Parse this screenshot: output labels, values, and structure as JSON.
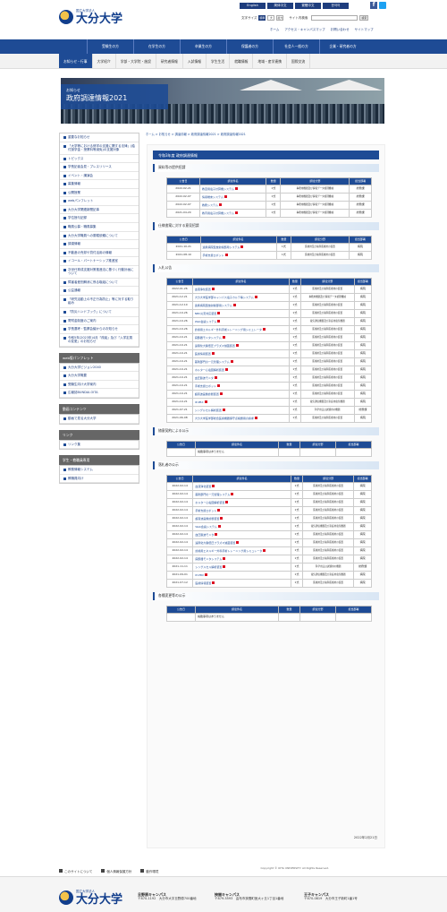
{
  "header": {
    "logo_sub": "国立大学法人",
    "logo_main": "大分大学",
    "langs": [
      "English",
      "简体中文",
      "繁體中文",
      "한국어"
    ],
    "text_size_label": "文字サイズ",
    "sizes": [
      "標準",
      "大",
      "最大"
    ],
    "search_label": "サイト内検索",
    "search_button": "検索",
    "util": [
      "ホーム",
      "アクセス・キャンパスマップ",
      "お問い合わせ",
      "サイトマップ"
    ]
  },
  "gnav": [
    "受験生の方",
    "在学生の方",
    "卒業生の方",
    "保護者の方",
    "社会人一般の方",
    "企業・研究者の方"
  ],
  "snav": [
    {
      "label": "お知らせ・行事",
      "active": true
    },
    {
      "label": "大学紹介",
      "active": false
    },
    {
      "label": "学部・大学院・施設",
      "active": false
    },
    {
      "label": "研究者情報",
      "active": false
    },
    {
      "label": "入試情報",
      "active": false
    },
    {
      "label": "学生生活",
      "active": false
    },
    {
      "label": "就職情報",
      "active": false
    },
    {
      "label": "地域・産学連携",
      "active": false
    },
    {
      "label": "国際交流",
      "active": false
    }
  ],
  "hero": {
    "small": "お知らせ",
    "title": "政府調達情報2021"
  },
  "breadcrumb": "ホーム > お知らせ > 調達情報 > 政府調達情報2021 > 政府調達情報2021",
  "sidebar": {
    "items": [
      "重要なお知らせ",
      "「大学等における修学の支援に関する法律」(給付奨学金・授業料等減免)の支援対象",
      "トピックス",
      "学長記者会見・プレスリリース",
      "イベント・講演会",
      "募集情報",
      "公開授業",
      "webパンフレット",
      "大分大学関連新聞記事",
      "学位授与記録",
      "職員公募・職員募集",
      "大分大学職員への委嘱依頼について",
      "調達情報",
      "不動産の売却や貸付活用の情報",
      "イコール・パートナーシップ推進室",
      "次世代育成支援対策推進法に基づく行動計画について",
      "障害者差別解消に係る取組について",
      "公益通報",
      "「研究活動上の不正行為防止」等に対する取り組み",
      "「防災ハンドブック」について",
      "寄附金制度のご案内",
      "学長選考・監察会議からのお知らせ",
      "令和5年(2023年)4月「改組」及び「入学定員の変更」のお知らせ"
    ],
    "panf_title": "web版パンフレット",
    "panf": [
      "大分大学ビジョン2040",
      "大分大学概要",
      "受験生向け大学案内",
      "広報誌BUNDAI-OITA"
    ],
    "video_title": "動画コンテンツ",
    "video": [
      "動画で見る大分大学"
    ],
    "link_title": "リンク",
    "link": [
      "リンク集"
    ],
    "student_title": "学生・教職員専用",
    "student": [
      "教務情報システム",
      "教職員向け"
    ]
  },
  "main": {
    "page_title": "令和3年度 政府調達情報",
    "s1": {
      "title": "資料等の提供招請",
      "headers": [
        "公告日",
        "調達件名",
        "数量",
        "調達分野",
        "担当部署"
      ],
      "rows": [
        [
          "2022-02-21",
          "教室用電子計算機システム",
          "1式",
          "事務用機器及び情報データ処理機械",
          "総務課"
        ],
        [
          "2022-02-07",
          "情報端末システム",
          "1式",
          "事務用機器及び情報データ処理機械",
          "総務課"
        ],
        [
          "2022-02-07",
          "教務システム",
          "1式",
          "事務用機器及び情報データ処理機械",
          "総務課"
        ],
        [
          "2021-04-20",
          "教育用電子計算機システム",
          "1式",
          "事務用機器及び情報データ処理機械",
          "総務課"
        ]
      ]
    },
    "s2": {
      "title": "仕様書案に対する意見招請",
      "headers": [
        "公告日",
        "調達件名",
        "数量",
        "調達分野",
        "担当部署"
      ],
      "rows": [
        [
          "2021-10-21",
          "連携病院型放射線部用システム",
          "1式",
          "医療用及び歯科医療用の装置",
          "病院"
        ],
        [
          "2021-08-10",
          "手術支援ロボット",
          "1式",
          "医療用及び歯科医療用の装置",
          "病院"
        ]
      ]
    },
    "s3": {
      "title": "入札公告",
      "headers": [
        "公告日",
        "調達件名",
        "数量",
        "調達分野",
        "担当部署"
      ],
      "rows": [
        [
          "2022-01-26",
          "血液浄化装置",
          "1式",
          "医療用及び歯科医療用の装置",
          "病院"
        ],
        [
          "2021-12-21",
          "大分大学医学部キャンパス電子カルテ等システム",
          "1式",
          "事務用機器及び情報データ処理機械",
          "病院"
        ],
        [
          "2021-12-10",
          "連携病院型放射線部用システム",
          "1式",
          "医療用及び歯科医療用の装置",
          "病院"
        ],
        [
          "2021-10-26",
          "NBC災害対応装置",
          "1式",
          "医療用及び歯科医療用の装置",
          "病院"
        ],
        [
          "2021-10-26",
          "Web会議システム",
          "1式",
          "電気通信機器及び家庭用電気機器",
          "病院"
        ],
        [
          "2021-10-26",
          "診療用エネルギー外科手術トレーニング用シミュレータ",
          "1式",
          "医療用及び歯科医療用の装置",
          "病院"
        ],
        [
          "2021-10-21",
          "麻酔器モニタシステム",
          "1式",
          "医療用及び歯科医療用の装置",
          "病院"
        ],
        [
          "2021-10-21",
          "遠隔化大腸低圧プラズマ滅菌装置",
          "1式",
          "医療用及び歯科医療用の装置",
          "病院"
        ],
        [
          "2021-10-21",
          "医療情報装置",
          "1式",
          "医療用及び歯科医療用の装置",
          "病院"
        ],
        [
          "2021-10-21",
          "薬剤部門の一元管理システム",
          "1式",
          "医療用及び歯科医療用の装置",
          "病院"
        ],
        [
          "2021-10-21",
          "ホルター心電図解析装置",
          "1式",
          "医療用及び歯科医療用の装置",
          "病院"
        ],
        [
          "2021-10-21",
          "血圧脈波モニタ",
          "1式",
          "医療用及び歯科医療用の装置",
          "病院"
        ],
        [
          "2021-10-21",
          "手術支援ロボット",
          "1式",
          "医療用及び歯科医療用の装置",
          "病院"
        ],
        [
          "2021-10-21",
          "超音波画像診断装置",
          "1式",
          "医療用及び歯科医療用の装置",
          "病院"
        ],
        [
          "2021-10-21",
          "IP-PBX",
          "1式",
          "電気通信機器及び家庭用電気機器",
          "病院"
        ],
        [
          "2021-07-21",
          "シングルセル解析装置",
          "1式",
          "科学用又は試験用の機器",
          "総務課"
        ],
        [
          "2021-06-08",
          "大分大学医学部総合医療機器保守点検費用の請求",
          "1式",
          "医療用及び歯科医療用の装置",
          "病院"
        ]
      ]
    },
    "s4": {
      "title": "随意契約による公示",
      "headers": [
        "公告日",
        "調達件名",
        "数量",
        "調達分野",
        "担当部署"
      ],
      "rows": [
        [
          "",
          "掲載事項はありません",
          "",
          "",
          ""
        ]
      ]
    },
    "s5": {
      "title": "落札者の公示",
      "headers": [
        "公告日",
        "調達件名",
        "数量",
        "調達分野",
        "担当部署"
      ],
      "rows": [
        [
          "2022-02-14",
          "血液浄化装置",
          "1式",
          "医療用及び歯科医療用の装置",
          "病院"
        ],
        [
          "2022-02-14",
          "薬剤部門の一元管理システム",
          "1式",
          "医療用及び歯科医療用の装置",
          "病院"
        ],
        [
          "2022-02-14",
          "ホルター心電図解析装置",
          "1式",
          "医療用及び歯科医療用の装置",
          "病院"
        ],
        [
          "2022-02-14",
          "手術支援ロボット",
          "1式",
          "医療用及び歯科医療用の装置",
          "病院"
        ],
        [
          "2022-02-14",
          "超音波画像診断装置",
          "1式",
          "医療用及び歯科医療用の装置",
          "病院"
        ],
        [
          "2022-02-14",
          "Web会議システム",
          "1式",
          "電気通信機器及び家庭用電気機器",
          "病院"
        ],
        [
          "2022-02-14",
          "血圧脈波モニタ",
          "1式",
          "医療用及び歯科医療用の装置",
          "病院"
        ],
        [
          "2022-02-14",
          "遠隔化大腸低圧プラズマ滅菌装置",
          "1式",
          "医療用及び歯科医療用の装置",
          "病院"
        ],
        [
          "2022-02-14",
          "診療用エネルギー外科手術トレーニング用シミュレータ",
          "1式",
          "医療用及び歯科医療用の装置",
          "病院"
        ],
        [
          "2022-02-14",
          "麻酔器モニタシステム",
          "1式",
          "医療用及び歯科医療用の装置",
          "病院"
        ],
        [
          "2021-11-11",
          "シングルセル解析装置",
          "1式",
          "科学用又は試験用の機器",
          "総務課"
        ],
        [
          "2021-09-01",
          "IP-PBX",
          "1式",
          "電気通信機器及び家庭用電気機器",
          "病院"
        ],
        [
          "2021-07-12",
          "医療情報装置",
          "1式",
          "医療用及び歯科医療用の装置",
          "病院"
        ]
      ]
    },
    "s6": {
      "title": "各種変更等の公示",
      "headers": [
        "公告日",
        "調達件名",
        "数量",
        "調達分野",
        "担当部署"
      ],
      "rows": [
        [
          "",
          "掲載事項はありません",
          "",
          "",
          ""
        ]
      ]
    },
    "updated": "2022年2月21日"
  },
  "footer": {
    "links": [
      "このサイトについて",
      "個人情報保護方針",
      "動作環境"
    ],
    "copyright": "Copyright © OITA UNIVERSITY. All Rights Reserved.",
    "campuses": [
      {
        "name": "旦野原キャンパス",
        "addr": "〒870-1192　大分市大字旦野原700番地"
      },
      {
        "name": "挾間キャンパス",
        "addr": "〒879-5593　由布市挾間町医大ヶ丘1丁目1番地"
      },
      {
        "name": "王子キャンパス",
        "addr": "〒870-0819　大分市王子新町1番1号"
      }
    ]
  }
}
